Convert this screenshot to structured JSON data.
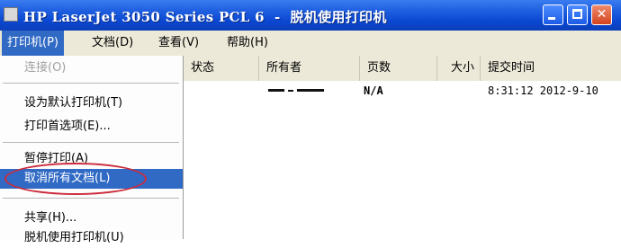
{
  "window": {
    "title": "HP LaserJet 3050 Series PCL 6  -  脱机使用打印机",
    "buttons": {
      "minimize": "",
      "maximize": "",
      "close": "✕"
    }
  },
  "menubar": {
    "items": [
      {
        "label": "打印机(P)"
      },
      {
        "label": "文档(D)"
      },
      {
        "label": "查看(V)"
      },
      {
        "label": "帮助(H)"
      }
    ]
  },
  "printer_menu": {
    "items": [
      {
        "label": "连接(O)",
        "disabled": true
      },
      {
        "label": "设为默认打印机(T)"
      },
      {
        "label": "打印首选项(E)..."
      },
      {
        "label": "暂停打印(A)"
      },
      {
        "label": "取消所有文档(L)",
        "selected": true
      },
      {
        "label": "共享(H)..."
      },
      {
        "label": "脱机使用打印机(U)"
      }
    ]
  },
  "job_list": {
    "columns": [
      "状态",
      "所有者",
      "页数",
      "大小",
      "提交时间"
    ],
    "rows": [
      {
        "status": "",
        "owner": "",
        "pages": "N/A",
        "size": "",
        "submitted": "8:31:12  2012-9-10"
      }
    ]
  },
  "colors": {
    "titlebar": "#0a47d2",
    "selection": "#316ac5",
    "annotation_circle": "#cc2a3a"
  }
}
